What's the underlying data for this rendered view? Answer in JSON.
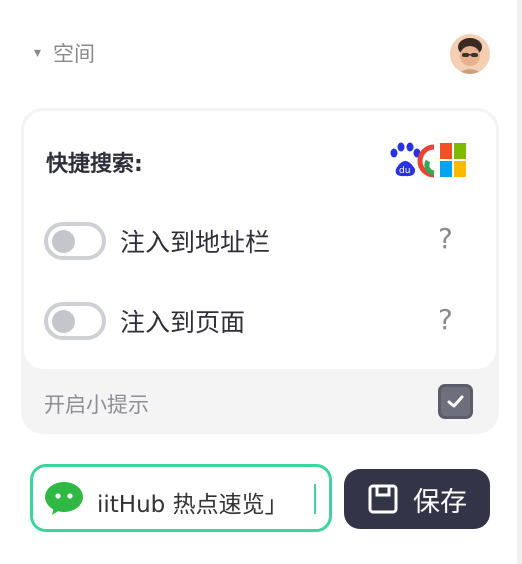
{
  "section": {
    "caret": "▾",
    "label": "空间"
  },
  "quick_search": {
    "title": "快捷搜索:",
    "inject_address_bar": {
      "label": "注入到地址栏",
      "enabled": false,
      "help": "?"
    },
    "inject_page": {
      "label": "注入到页面",
      "enabled": false,
      "help": "?"
    },
    "engine_icons": [
      "baidu-icon",
      "google-icon",
      "bing-icon"
    ]
  },
  "tips": {
    "label": "开启小提示",
    "checked": true
  },
  "input": {
    "value": "iitHub 热点速览」",
    "icon": "wechat-icon"
  },
  "save_button": {
    "label": "保存",
    "icon": "floppy-icon"
  },
  "colors": {
    "accent": "#3fd39d",
    "button": "#343448",
    "panel": "#f4f4f5"
  }
}
